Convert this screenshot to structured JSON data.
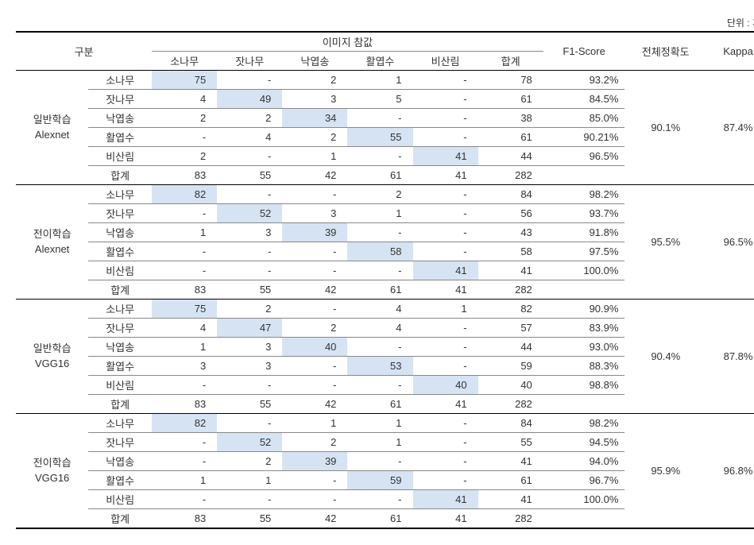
{
  "unit": "단위 : 개수",
  "hdr": {
    "gubun": "구분",
    "imgtruth": "이미지 참값",
    "f1": "F1-Score",
    "acc": "전체정확도",
    "kappa": "Kappa"
  },
  "cols": [
    "소나무",
    "잣나무",
    "낙엽송",
    "활엽수",
    "비산림",
    "합계"
  ],
  "rows": [
    "소나무",
    "잣나무",
    "낙엽송",
    "활엽수",
    "비산림",
    "합계"
  ],
  "groups": [
    {
      "name": [
        "일반학습",
        "Alexnet"
      ],
      "acc": "90.1%",
      "kappa": "87.4%",
      "data": [
        {
          "v": [
            "75",
            "-",
            "2",
            "1",
            "-",
            "78"
          ],
          "f1": "93.2%",
          "d": 0
        },
        {
          "v": [
            "4",
            "49",
            "3",
            "5",
            "-",
            "61"
          ],
          "f1": "84.5%",
          "d": 1
        },
        {
          "v": [
            "2",
            "2",
            "34",
            "-",
            "-",
            "38"
          ],
          "f1": "85.0%",
          "d": 2
        },
        {
          "v": [
            "-",
            "4",
            "2",
            "55",
            "-",
            "61"
          ],
          "f1": "90.21%",
          "d": 3
        },
        {
          "v": [
            "2",
            "-",
            "1",
            "-",
            "41",
            "44"
          ],
          "f1": "96.5%",
          "d": 4
        },
        {
          "v": [
            "83",
            "55",
            "42",
            "61",
            "41",
            "282"
          ],
          "f1": "",
          "d": -1
        }
      ]
    },
    {
      "name": [
        "전이학습",
        "Alexnet"
      ],
      "acc": "95.5%",
      "kappa": "96.5%",
      "data": [
        {
          "v": [
            "82",
            "-",
            "-",
            "2",
            "-",
            "84"
          ],
          "f1": "98.2%",
          "d": 0
        },
        {
          "v": [
            "-",
            "52",
            "3",
            "1",
            "-",
            "56"
          ],
          "f1": "93.7%",
          "d": 1
        },
        {
          "v": [
            "1",
            "3",
            "39",
            "-",
            "-",
            "43"
          ],
          "f1": "91.8%",
          "d": 2
        },
        {
          "v": [
            "-",
            "-",
            "-",
            "58",
            "-",
            "58"
          ],
          "f1": "97.5%",
          "d": 3
        },
        {
          "v": [
            "-",
            "-",
            "-",
            "-",
            "41",
            "41"
          ],
          "f1": "100.0%",
          "d": 4
        },
        {
          "v": [
            "83",
            "55",
            "42",
            "61",
            "41",
            "282"
          ],
          "f1": "",
          "d": -1
        }
      ]
    },
    {
      "name": [
        "일반학습",
        "VGG16"
      ],
      "acc": "90.4%",
      "kappa": "87.8%",
      "data": [
        {
          "v": [
            "75",
            "2",
            "-",
            "4",
            "1",
            "82"
          ],
          "f1": "90.9%",
          "d": 0
        },
        {
          "v": [
            "4",
            "47",
            "2",
            "4",
            "-",
            "57"
          ],
          "f1": "83.9%",
          "d": 1
        },
        {
          "v": [
            "1",
            "3",
            "40",
            "-",
            "-",
            "44"
          ],
          "f1": "93.0%",
          "d": 2
        },
        {
          "v": [
            "3",
            "3",
            "-",
            "53",
            "-",
            "59"
          ],
          "f1": "88.3%",
          "d": 3
        },
        {
          "v": [
            "-",
            "-",
            "-",
            "-",
            "40",
            "40"
          ],
          "f1": "98.8%",
          "d": 4
        },
        {
          "v": [
            "83",
            "55",
            "42",
            "61",
            "41",
            "282"
          ],
          "f1": "",
          "d": -1
        }
      ]
    },
    {
      "name": [
        "전이학습",
        "VGG16"
      ],
      "acc": "95.9%",
      "kappa": "96.8%",
      "data": [
        {
          "v": [
            "82",
            "-",
            "1",
            "1",
            "-",
            "84"
          ],
          "f1": "98.2%",
          "d": 0
        },
        {
          "v": [
            "-",
            "52",
            "2",
            "1",
            "-",
            "55"
          ],
          "f1": "94.5%",
          "d": 1
        },
        {
          "v": [
            "-",
            "2",
            "39",
            "-",
            "-",
            "41"
          ],
          "f1": "94.0%",
          "d": 2
        },
        {
          "v": [
            "1",
            "1",
            "-",
            "59",
            "-",
            "61"
          ],
          "f1": "96.7%",
          "d": 3
        },
        {
          "v": [
            "-",
            "-",
            "-",
            "-",
            "41",
            "41"
          ],
          "f1": "100.0%",
          "d": 4
        },
        {
          "v": [
            "83",
            "55",
            "42",
            "61",
            "41",
            "282"
          ],
          "f1": "",
          "d": -1
        }
      ]
    }
  ]
}
